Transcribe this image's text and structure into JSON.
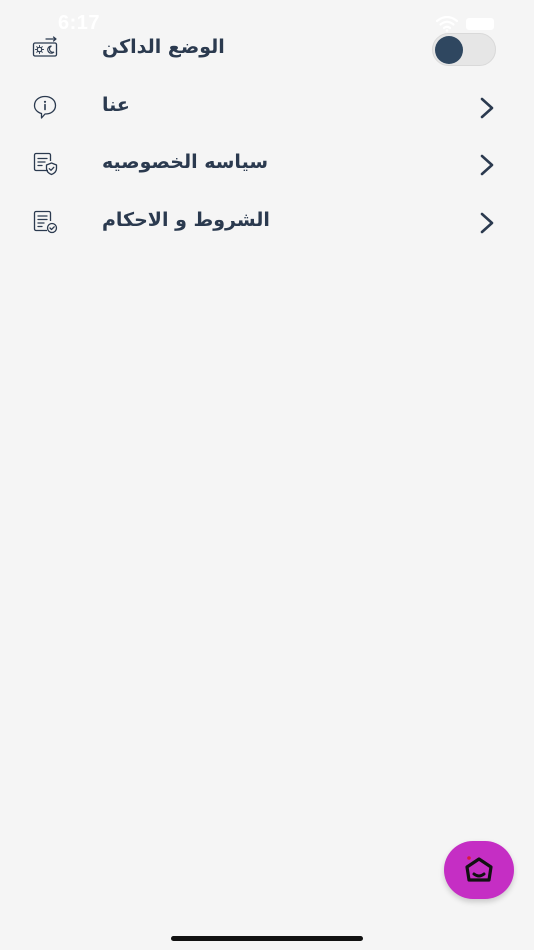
{
  "status_bar": {
    "time": "6:17"
  },
  "menu": {
    "items": [
      {
        "label": "الوضع الداكن",
        "icon": "dark-mode-icon",
        "control": "toggle",
        "toggle_on": true
      },
      {
        "label": "عنا",
        "icon": "info-icon",
        "control": "chevron"
      },
      {
        "label": "سياسه الخصوصيه",
        "icon": "privacy-document-icon",
        "control": "chevron"
      },
      {
        "label": "الشروط و الاحكام",
        "icon": "terms-document-icon",
        "control": "chevron"
      }
    ]
  },
  "fab": {
    "icon": "home-icon"
  },
  "colors": {
    "background": "#f5f5f5",
    "text": "#2b3a4f",
    "toggle_knob": "#2f4760",
    "toggle_track": "#e6e6e6",
    "fab": "#c52ec4",
    "fab_dot": "#d81b3c"
  }
}
